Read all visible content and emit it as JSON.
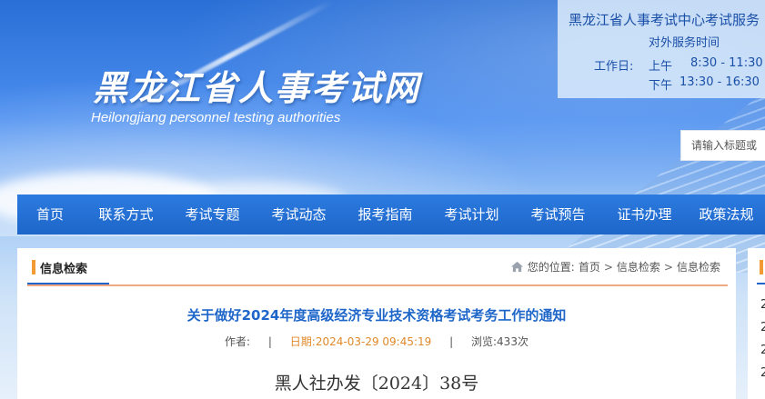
{
  "header": {
    "site_title": "黑龙江省人事考试网",
    "site_subtitle": "Heilongjiang personnel testing authorities"
  },
  "service": {
    "title": "黑龙江省人事考试中心考试服务",
    "subtitle": "对外服务时间",
    "workday_label": "工作日:",
    "morning_label": "上午",
    "morning_hours": "8:30 - 11:30",
    "afternoon_label": "下午",
    "afternoon_hours": "13:30 - 16:30"
  },
  "search": {
    "placeholder": "请输入标题或"
  },
  "nav": {
    "items": [
      {
        "label": "首页"
      },
      {
        "label": "联系方式"
      },
      {
        "label": "考试专题"
      },
      {
        "label": "考试动态"
      },
      {
        "label": "报考指南"
      },
      {
        "label": "考试计划"
      },
      {
        "label": "考试预告"
      },
      {
        "label": "证书办理"
      },
      {
        "label": "政策法规"
      }
    ]
  },
  "section": {
    "title": "信息检索",
    "breadcrumb": {
      "prefix": "您的位置:",
      "items": [
        "首页",
        "信息检索",
        "信息检索"
      ],
      "separator": ">"
    }
  },
  "article": {
    "title": "关于做好2024年度高级经济专业技术资格考试考务工作的通知",
    "author_label": "作者:",
    "author": "",
    "date_label": "日期:",
    "date": "2024-03-29 09:45:19",
    "views_label": "浏览:",
    "views": "433次",
    "doc_number": "黑人社办发〔2024〕38号"
  },
  "side": {
    "numbers": [
      "2",
      "2",
      "2",
      "2"
    ]
  },
  "colors": {
    "nav_blue": "#1e66c9",
    "accent_orange": "#f29b36",
    "link_blue": "#1e66c9",
    "date_orange": "#e08a2a"
  }
}
